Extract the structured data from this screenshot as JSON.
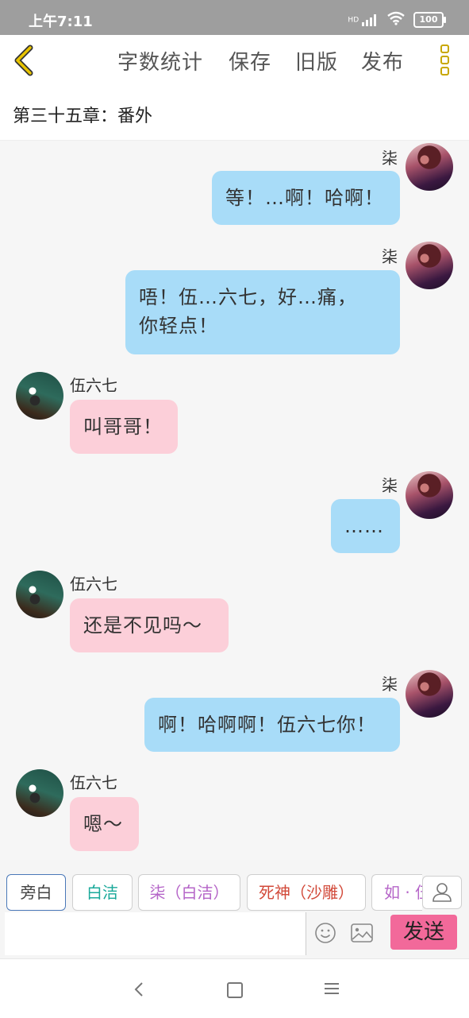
{
  "status": {
    "time": "上午7:11",
    "battery": "100",
    "hd": "HD"
  },
  "toolbar": {
    "word_count": "字数统计",
    "save": "保存",
    "old_version": "旧版",
    "publish": "发布"
  },
  "chapter": {
    "title": "第三十五章：番外"
  },
  "messages": [
    {
      "side": "right",
      "name": "柒",
      "text": "等！…啊！哈啊！"
    },
    {
      "side": "right",
      "name": "柒",
      "text_line1": "唔！伍…六七，好…痛，",
      "text_line2": "你轻点！"
    },
    {
      "side": "left",
      "name": "伍六七",
      "text": "叫哥哥！"
    },
    {
      "side": "right",
      "name": "柒",
      "text": "……"
    },
    {
      "side": "left",
      "name": "伍六七",
      "text": "还是不见吗～"
    },
    {
      "side": "right",
      "name": "柒",
      "text": "啊！哈啊啊！伍六七你！"
    },
    {
      "side": "left",
      "name": "伍六七",
      "text": "嗯～"
    }
  ],
  "roles": [
    {
      "label": "旁白",
      "color": "#444444"
    },
    {
      "label": "白洁",
      "color": "#1aa99a"
    },
    {
      "label": "柒（白洁）",
      "color": "#b565c8"
    },
    {
      "label": "死神（沙雕）",
      "color": "#d24a3a"
    },
    {
      "label": "如 · 伍",
      "color": "#b565c8"
    }
  ],
  "input": {
    "placeholder": "",
    "value": ""
  },
  "send": {
    "label": "发送"
  },
  "colors": {
    "right_bubble": "#a8dcf8",
    "left_bubble": "#fccfd9",
    "send_button": "#f2699a",
    "accent_icons": "#c8a700"
  },
  "icons": [
    "back-arrow-icon",
    "more-menu-icon",
    "emoji-icon",
    "image-icon",
    "person-icon",
    "nav-back-icon",
    "nav-home-icon",
    "nav-menu-icon"
  ]
}
